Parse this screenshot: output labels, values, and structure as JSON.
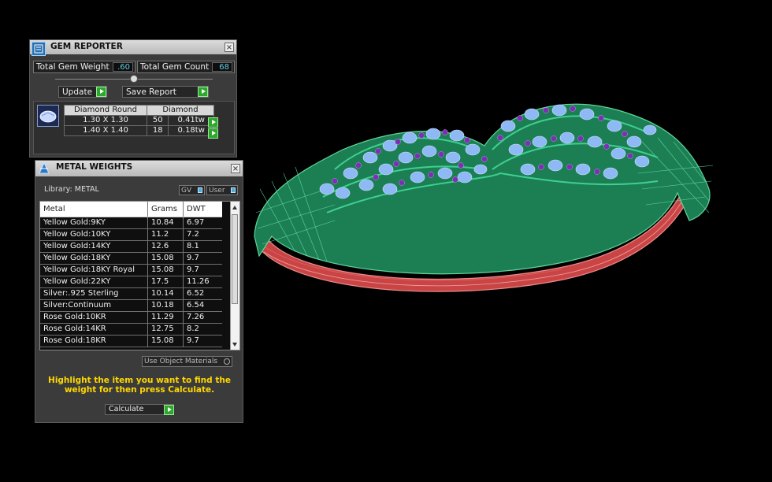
{
  "gem_reporter": {
    "title": "GEM REPORTER",
    "close_glyph": "×",
    "total_weight_label": "Total Gem Weight",
    "total_weight_value": ".60",
    "total_count_label": "Total Gem Count",
    "total_count_value": "68",
    "update_label": "Update",
    "save_label": "Save Report",
    "table_headers": [
      "Diamond Round",
      "Diamond"
    ],
    "rows": [
      {
        "size": "1.30 X 1.30",
        "count": "50",
        "weight": "0.41tw"
      },
      {
        "size": "1.40 X 1.40",
        "count": "18",
        "weight": "0.18tw"
      }
    ]
  },
  "metal_weights": {
    "title": "METAL WEIGHTS",
    "close_glyph": "×",
    "library_label": "Library: METAL",
    "gv_label": "GV",
    "user_label": "User",
    "columns": [
      "Metal",
      "Grams",
      "DWT"
    ],
    "rows": [
      {
        "metal": "Yellow Gold:9KY",
        "grams": "10.84",
        "dwt": "6.97"
      },
      {
        "metal": "Yellow Gold:10KY",
        "grams": "11.2",
        "dwt": "7.2"
      },
      {
        "metal": "Yellow Gold:14KY",
        "grams": "12.6",
        "dwt": "8.1"
      },
      {
        "metal": "Yellow Gold:18KY",
        "grams": "15.08",
        "dwt": "9.7"
      },
      {
        "metal": "Yellow Gold:18KY Royal",
        "grams": "15.08",
        "dwt": "9.7"
      },
      {
        "metal": "Yellow Gold:22KY",
        "grams": "17.5",
        "dwt": "11.26"
      },
      {
        "metal": "Silver:.925 Sterling",
        "grams": "10.14",
        "dwt": "6.52"
      },
      {
        "metal": "Silver:Continuum",
        "grams": "10.18",
        "dwt": "6.54"
      },
      {
        "metal": "Rose Gold:10KR",
        "grams": "11.29",
        "dwt": "7.26"
      },
      {
        "metal": "Rose Gold:14KR",
        "grams": "12.75",
        "dwt": "8.2"
      },
      {
        "metal": "Rose Gold:18KR",
        "grams": "15.08",
        "dwt": "9.7"
      }
    ],
    "use_object_materials_label": "Use Object Materials",
    "instruction": "Highlight the item you want to find the weight for then press Calculate.",
    "calculate_label": "Calculate"
  },
  "colors": {
    "panel_bg": "#3b3b3b",
    "value_cyan": "#63d0e8",
    "instruction_yellow": "#ffd800",
    "accent_green": "#2da82d",
    "model_green": "#1f8a5a",
    "model_red": "#d24a4a",
    "gem_blue": "#8fb9f5",
    "gem_purple": "#7c2fb0"
  },
  "icons": [
    "gem-reporter-icon",
    "diamond-icon",
    "metal-weights-icon",
    "close-icon",
    "play-arrow-icon",
    "slider-knob-icon",
    "scroll-up-arrow-icon",
    "scroll-down-arrow-icon"
  ]
}
